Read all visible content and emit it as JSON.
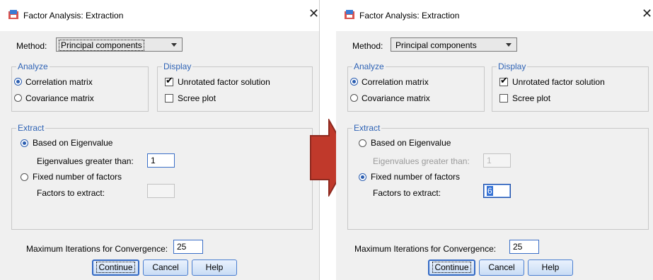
{
  "dialogs": [
    {
      "title": "Factor Analysis: Extraction",
      "method_label": "Method:",
      "method_value": "Principal components",
      "analyze": {
        "title": "Analyze",
        "correlation": "Correlation matrix",
        "covariance": "Covariance matrix",
        "selected": "correlation"
      },
      "display": {
        "title": "Display",
        "unrotated": "Unrotated factor solution",
        "unrotated_checked": true,
        "scree": "Scree plot",
        "scree_checked": false
      },
      "extract": {
        "title": "Extract",
        "based_eigen": "Based on Eigenvalue",
        "eigen_greater": "Eigenvalues greater than:",
        "eigen_value": "1",
        "fixed_number": "Fixed number of factors",
        "factors_to_extract": "Factors to extract:",
        "factors_value": "",
        "selected": "eigen"
      },
      "max_iter_label": "Maximum Iterations for Convergence:",
      "max_iter_value": "25",
      "buttons": {
        "continue": "Continue",
        "cancel": "Cancel",
        "help": "Help"
      }
    },
    {
      "title": "Factor Analysis: Extraction",
      "method_label": "Method:",
      "method_value": "Principal components",
      "analyze": {
        "title": "Analyze",
        "correlation": "Correlation matrix",
        "covariance": "Covariance matrix",
        "selected": "correlation"
      },
      "display": {
        "title": "Display",
        "unrotated": "Unrotated factor solution",
        "unrotated_checked": true,
        "scree": "Scree plot",
        "scree_checked": false
      },
      "extract": {
        "title": "Extract",
        "based_eigen": "Based on Eigenvalue",
        "eigen_greater": "Eigenvalues greater than:",
        "eigen_value": "1",
        "fixed_number": "Fixed number of factors",
        "factors_to_extract": "Factors to extract:",
        "factors_value": "6",
        "selected": "fixed"
      },
      "max_iter_label": "Maximum Iterations for Convergence:",
      "max_iter_value": "25",
      "buttons": {
        "continue": "Continue",
        "cancel": "Cancel",
        "help": "Help"
      }
    }
  ],
  "close_icon": "close-icon",
  "app_icon": "spss-app-icon",
  "arrow_icon": "right-arrow-icon",
  "colors": {
    "group_title": "#2f63b5",
    "arrow_fill": "#c0392b",
    "selection": "#3572d6"
  }
}
